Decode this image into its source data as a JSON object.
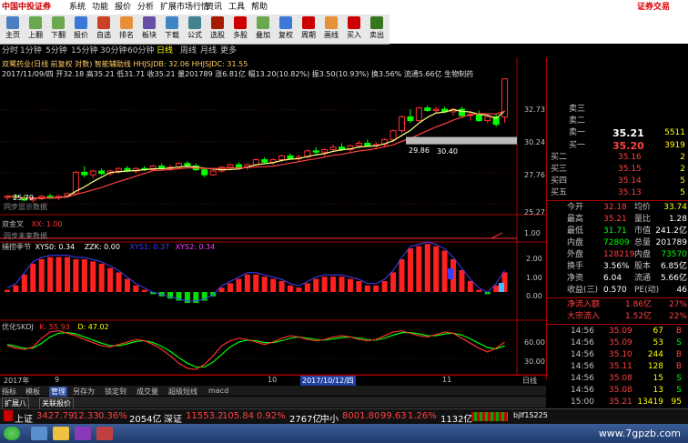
{
  "menu": {
    "logo": "中国中投证券",
    "items": [
      "系统",
      "功能",
      "报价",
      "分析",
      "扩展市场行情",
      "资讯",
      "工具",
      "帮助"
    ],
    "right_label": "证券交易"
  },
  "toolbar": {
    "buttons": [
      {
        "label": "主页",
        "icon": "home-icon",
        "color": "#4a7fc0"
      },
      {
        "label": "上翻",
        "icon": "up-icon",
        "color": "#6aa84f"
      },
      {
        "label": "下翻",
        "icon": "down-icon",
        "color": "#6aa84f"
      },
      {
        "label": "报价",
        "icon": "quote-icon",
        "color": "#3c78d8"
      },
      {
        "label": "自选",
        "icon": "favorite-icon",
        "color": "#cc4125"
      },
      {
        "label": "排名",
        "icon": "rank-icon",
        "color": "#e69138"
      },
      {
        "label": "板块",
        "icon": "sector-icon",
        "color": "#674ea7"
      },
      {
        "label": "下载",
        "icon": "download-icon",
        "color": "#3d85c6"
      },
      {
        "label": "公式",
        "icon": "formula-icon",
        "color": "#45818e"
      },
      {
        "label": "选股",
        "icon": "stock-pick-icon",
        "color": "#a61c00"
      },
      {
        "label": "多股",
        "icon": "multi-stock-icon",
        "color": "#cc0000"
      },
      {
        "label": "叠加",
        "icon": "overlay-icon",
        "color": "#6aa84f"
      },
      {
        "label": "复权",
        "icon": "restore-icon",
        "color": "#3c78d8"
      },
      {
        "label": "周期",
        "icon": "period-icon",
        "color": "#cc0000"
      },
      {
        "label": "画线",
        "icon": "draw-line-icon",
        "color": "#e69138"
      },
      {
        "label": "买入",
        "icon": "buy-icon",
        "color": "#cc0000"
      },
      {
        "label": "卖出",
        "icon": "sell-icon",
        "color": "#38761d"
      }
    ]
  },
  "periods": [
    "分时",
    "1分钟",
    "5分钟",
    "15分钟",
    "30分钟",
    "60分钟",
    "日线",
    "周线",
    "月线",
    "更多"
  ],
  "active_period": "日线",
  "main_chart": {
    "title": "双鹭药业(日线 前复权 対数) 智能辅助线 HHJSJDB: 32.06 HHJSJDC: 31.55",
    "info": "2017/11/09/四 开32.18 高35.21 低31.71 收35.21 量201789 涨6.81亿 幅13.20(10.82%) 振3.50(10.93%) 换3.56% 流通5.66亿 生物制药",
    "price_ticks": [
      "32.73",
      "30.24",
      "27.76",
      "25.27"
    ],
    "annotations": [
      "29.86",
      "30.40",
      "25.79"
    ],
    "footer_text": "同步显示数据"
  },
  "chart_data": {
    "type": "candlestick",
    "dates": [
      "2017-08-14",
      "2017-08-15",
      "2017-08-16",
      "2017-08-17",
      "2017-08-18",
      "2017-08-21",
      "2017-08-22",
      "2017-08-23",
      "2017-08-24",
      "2017-08-25",
      "2017-08-28",
      "2017-08-29",
      "2017-08-30",
      "2017-08-31",
      "2017-09-01",
      "2017-09-04",
      "2017-09-05",
      "2017-09-06",
      "2017-09-07",
      "2017-09-08",
      "2017-09-11",
      "2017-09-12",
      "2017-09-13",
      "2017-09-14",
      "2017-09-15",
      "2017-09-18",
      "2017-09-19",
      "2017-09-20",
      "2017-09-21",
      "2017-09-22",
      "2017-09-25",
      "2017-09-26",
      "2017-09-27",
      "2017-09-28",
      "2017-09-29",
      "2017-10-09",
      "2017-10-10",
      "2017-10-11",
      "2017-10-12",
      "2017-10-13",
      "2017-10-16",
      "2017-10-17",
      "2017-10-18",
      "2017-10-19",
      "2017-10-20",
      "2017-10-23",
      "2017-10-24",
      "2017-10-25",
      "2017-10-26",
      "2017-10-27",
      "2017-10-30",
      "2017-10-31",
      "2017-11-01",
      "2017-11-02",
      "2017-11-03",
      "2017-11-06",
      "2017-11-07",
      "2017-11-08",
      "2017-11-09"
    ],
    "ohlc": [
      [
        25.8,
        26.0,
        25.6,
        25.9
      ],
      [
        25.9,
        26.1,
        25.7,
        25.8
      ],
      [
        25.8,
        26.0,
        25.5,
        25.6
      ],
      [
        25.6,
        25.9,
        25.4,
        25.7
      ],
      [
        25.7,
        26.0,
        25.6,
        25.9
      ],
      [
        25.9,
        26.1,
        25.7,
        25.8
      ],
      [
        25.8,
        26.0,
        25.6,
        25.9
      ],
      [
        25.9,
        26.2,
        25.8,
        26.1
      ],
      [
        26.1,
        27.9,
        26.0,
        27.8
      ],
      [
        27.8,
        28.3,
        27.4,
        27.6
      ],
      [
        27.6,
        28.0,
        27.3,
        27.9
      ],
      [
        27.9,
        28.1,
        27.6,
        27.7
      ],
      [
        27.7,
        28.0,
        27.5,
        27.9
      ],
      [
        27.9,
        28.2,
        27.7,
        28.1
      ],
      [
        28.1,
        28.3,
        27.8,
        27.9
      ],
      [
        27.9,
        28.2,
        27.7,
        28.1
      ],
      [
        28.1,
        28.3,
        27.9,
        28.0
      ],
      [
        28.0,
        28.4,
        27.9,
        28.3
      ],
      [
        28.3,
        28.5,
        28.0,
        28.1
      ],
      [
        28.1,
        28.4,
        27.9,
        28.2
      ],
      [
        28.2,
        28.6,
        28.1,
        28.5
      ],
      [
        28.5,
        28.7,
        28.2,
        28.3
      ],
      [
        28.3,
        28.5,
        27.9,
        28.0
      ],
      [
        28.0,
        28.2,
        27.4,
        27.6
      ],
      [
        27.6,
        28.0,
        27.5,
        27.9
      ],
      [
        27.9,
        28.3,
        27.8,
        28.2
      ],
      [
        28.2,
        28.5,
        28.0,
        28.4
      ],
      [
        28.4,
        28.6,
        28.1,
        28.2
      ],
      [
        28.2,
        28.5,
        28.0,
        28.4
      ],
      [
        28.4,
        28.9,
        28.3,
        28.8
      ],
      [
        28.8,
        29.0,
        28.5,
        28.6
      ],
      [
        28.6,
        28.9,
        28.4,
        28.8
      ],
      [
        28.8,
        29.2,
        28.6,
        29.1
      ],
      [
        29.1,
        29.3,
        28.8,
        28.9
      ],
      [
        28.9,
        29.2,
        28.7,
        29.0
      ],
      [
        29.0,
        29.6,
        28.9,
        29.5
      ],
      [
        29.5,
        29.8,
        29.2,
        29.4
      ],
      [
        29.4,
        29.7,
        29.1,
        29.6
      ],
      [
        29.6,
        30.0,
        29.4,
        29.8
      ],
      [
        29.8,
        30.1,
        29.5,
        29.6
      ],
      [
        29.6,
        30.0,
        29.4,
        29.9
      ],
      [
        29.9,
        30.3,
        29.7,
        30.1
      ],
      [
        30.1,
        30.4,
        29.8,
        29.9
      ],
      [
        29.9,
        30.2,
        29.6,
        30.0
      ],
      [
        30.0,
        30.5,
        29.8,
        30.4
      ],
      [
        30.4,
        31.2,
        30.2,
        31.1
      ],
      [
        31.1,
        32.3,
        30.9,
        32.2
      ],
      [
        32.2,
        32.8,
        31.7,
        31.9
      ],
      [
        31.9,
        33.0,
        31.8,
        32.9
      ],
      [
        32.9,
        33.1,
        32.6,
        32.7
      ],
      [
        32.7,
        33.0,
        32.5,
        32.8
      ],
      [
        32.8,
        33.0,
        32.5,
        32.6
      ],
      [
        32.6,
        32.9,
        32.3,
        32.8
      ],
      [
        32.8,
        33.0,
        32.1,
        32.3
      ],
      [
        32.3,
        32.6,
        31.9,
        32.4
      ],
      [
        32.4,
        32.7,
        31.8,
        31.9
      ],
      [
        31.9,
        32.3,
        31.7,
        32.2
      ],
      [
        32.2,
        32.4,
        31.4,
        31.6
      ],
      [
        32.18,
        35.21,
        31.71,
        35.21
      ]
    ],
    "price_range": [
      24.8,
      33.6
    ],
    "indicators": {
      "hhjsjdb": 32.06,
      "hhjsjdc": 31.55
    }
  },
  "sub_panel_1": {
    "title": "双金叉",
    "value_label": "XX: 1.00",
    "tick": "1.00",
    "footer_text": "同步未来数据"
  },
  "sub_panel_2": {
    "title": "捕捞季节",
    "xys0": "XYS0: 0.34",
    "zzk": "ZZK: 0.00",
    "xys1": "XYS1: 0.37",
    "xys2": "XYS2: 0.34",
    "ticks": [
      "2.00",
      "1.00",
      "0.00"
    ],
    "bars": [
      0.1,
      0.3,
      0.8,
      1.3,
      1.5,
      1.6,
      1.6,
      1.6,
      1.5,
      1.5,
      1.4,
      1.3,
      1.1,
      0.9,
      0.6,
      0.3,
      0.1,
      -0.1,
      -0.2,
      -0.3,
      -0.4,
      -0.5,
      -0.5,
      -0.4,
      -0.2,
      0.2,
      0.4,
      0.6,
      0.8,
      0.8,
      0.7,
      0.6,
      0.5,
      0.3,
      0.2,
      0.4,
      0.6,
      0.7,
      0.7,
      0.7,
      0.6,
      0.5,
      0.3,
      0.3,
      0.5,
      0.9,
      1.5,
      2.0,
      2.1,
      2.2,
      2.1,
      1.9,
      1.5,
      1.0,
      0.5,
      0.1,
      -0.1,
      0.3,
      0.9
    ]
  },
  "sub_panel_3": {
    "title": "优化SKDJ",
    "k_label": "K: 55.93",
    "d_label": "D: 47.02",
    "ticks": [
      "60.00",
      "30.00"
    ],
    "k": [
      50,
      46,
      44,
      48,
      62,
      72,
      74,
      70,
      66,
      60,
      55,
      50,
      48,
      52,
      56,
      60,
      58,
      52,
      44,
      34,
      22,
      14,
      12,
      20,
      34,
      50,
      58,
      62,
      60,
      56,
      52,
      56,
      62,
      66,
      64,
      60,
      58,
      60,
      64,
      66,
      64,
      60,
      58,
      60,
      66,
      72,
      74,
      70,
      66,
      64,
      68,
      72,
      70,
      62,
      54,
      46,
      40,
      46,
      56
    ],
    "d": [
      52,
      49,
      46,
      46,
      54,
      64,
      70,
      71,
      69,
      64,
      59,
      54,
      50,
      50,
      53,
      57,
      58,
      55,
      49,
      41,
      31,
      22,
      16,
      16,
      24,
      36,
      48,
      56,
      59,
      58,
      55,
      55,
      58,
      62,
      64,
      62,
      60,
      59,
      61,
      63,
      64,
      62,
      60,
      59,
      62,
      67,
      71,
      71,
      69,
      66,
      66,
      69,
      70,
      67,
      61,
      54,
      47,
      45,
      50
    ]
  },
  "date_axis": {
    "labels": [
      "2017年",
      "9",
      "10",
      "2017/10/12/四",
      "11"
    ],
    "right_label": "日线"
  },
  "bottom_tabs": [
    "指标",
    "模板",
    "管理",
    "另存为",
    "锁定到",
    "成交量",
    "超级短线",
    "macd"
  ],
  "bottom_tabs2": [
    "扩展八",
    "关联报价"
  ],
  "right_panel": {
    "asks": [
      {
        "label": "卖三",
        "price": "",
        "vol": ""
      },
      {
        "label": "卖二",
        "price": "",
        "vol": ""
      },
      {
        "label": "卖一",
        "price": "35.21",
        "vol": "5511"
      }
    ],
    "current": {
      "label": "买一",
      "price": "35.20",
      "vol": "3919"
    },
    "bids": [
      {
        "label": "买二",
        "price": "35.16",
        "vol": "2"
      },
      {
        "label": "买三",
        "price": "35.15",
        "vol": "2"
      },
      {
        "label": "买四",
        "price": "35.14",
        "vol": "5"
      },
      {
        "label": "买五",
        "price": "35.13",
        "vol": "5"
      }
    ],
    "stats": [
      {
        "l1": "今开",
        "v1": "32.18",
        "l2": "均价",
        "v2": "33.74",
        "c1": "#ff4040",
        "c2": "#ffff00"
      },
      {
        "l1": "最高",
        "v1": "35.21",
        "l2": "量比",
        "v2": "1.28",
        "c1": "#ff4040",
        "c2": "#ffffff"
      },
      {
        "l1": "最低",
        "v1": "31.71",
        "l2": "市值",
        "v2": "241.2亿",
        "c1": "#00ff00",
        "c2": "#ffffff"
      },
      {
        "l1": "内盘",
        "v1": "72809",
        "l2": "总量",
        "v2": "201789",
        "c1": "#00ff00",
        "c2": "#ffffff"
      },
      {
        "l1": "外盘",
        "v1": "128219",
        "l2": "内盘",
        "v2": "73570",
        "c1": "#ff4040",
        "c2": "#00ff00"
      },
      {
        "l1": "换手",
        "v1": "3.56%",
        "l2": "股本",
        "v2": "6.85亿",
        "c1": "#ffffff",
        "c2": "#ffffff"
      },
      {
        "l1": "净资",
        "v1": "6.04",
        "l2": "流通",
        "v2": "5.66亿",
        "c1": "#ffffff",
        "c2": "#ffffff"
      },
      {
        "l1": "收益(三)",
        "v1": "0.570",
        "l2": "PE(动)",
        "v2": "46",
        "c1": "#ffffff",
        "c2": "#ffffff"
      }
    ],
    "flows": [
      {
        "label": "净流入额",
        "value": "1.86亿",
        "pct": "27%"
      },
      {
        "label": "大宗流入",
        "value": "1.52亿",
        "pct": "22%"
      }
    ],
    "ticks": [
      {
        "time": "14:56",
        "price": "35.09",
        "vol": "67",
        "side": "B"
      },
      {
        "time": "14:56",
        "price": "35.09",
        "vol": "53",
        "side": "S"
      },
      {
        "time": "14:56",
        "price": "35.10",
        "vol": "244",
        "side": "B"
      },
      {
        "time": "14:56",
        "price": "35.11",
        "vol": "128",
        "side": "B"
      },
      {
        "time": "14:56",
        "price": "35.08",
        "vol": "15",
        "side": "S"
      },
      {
        "time": "14:56",
        "price": "35.08",
        "vol": "13",
        "side": "S"
      },
      {
        "time": "15:00",
        "price": "35.21",
        "vol": "13419",
        "side": "95"
      }
    ]
  },
  "status_bar": {
    "sh_label": "上证",
    "sh_value": "3427.79",
    "sh_change": "12.33",
    "sh_pct": "0.36%",
    "sh_amount": "2054亿",
    "sz_label": "深证",
    "sz_value": "11553.2",
    "sz_change": "105.84",
    "sz_pct": "0.92%",
    "sz_amount": "2767亿",
    "zx_label": "中小",
    "zx_value": "8001.80",
    "zx_change": "99.63",
    "zx_pct": "1.26%",
    "zx_amount": "1132亿",
    "right_text": "bjlf1S225"
  },
  "watermark": "www.7gpzb.com"
}
